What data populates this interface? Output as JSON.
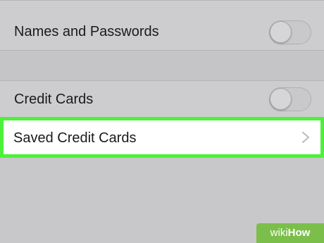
{
  "settings": {
    "names_passwords": {
      "label": "Names and Passwords",
      "toggle_on": false
    },
    "credit_cards": {
      "label": "Credit Cards",
      "toggle_on": false
    },
    "saved_credit_cards": {
      "label": "Saved Credit Cards",
      "icon": "chevron-right-icon"
    }
  },
  "watermark": {
    "wiki": "wiki",
    "how": "How"
  },
  "colors": {
    "background": "#c8c8ca",
    "highlight": "#4cf23a",
    "selected_row": "#ffffff",
    "watermark": "#7bbf4a"
  }
}
